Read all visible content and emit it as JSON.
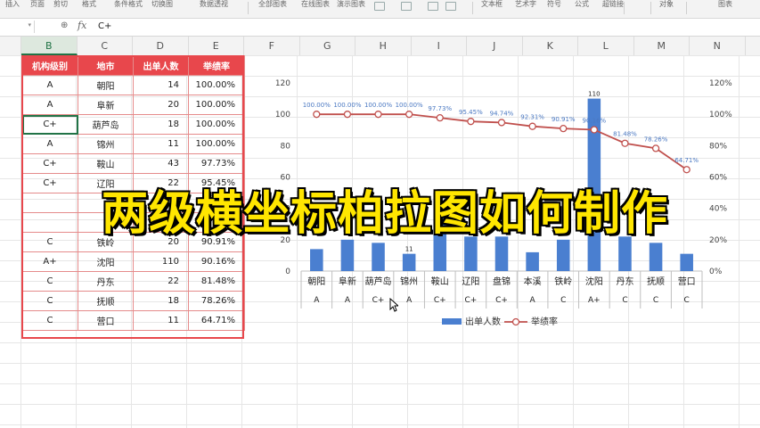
{
  "ribbon": {
    "items": [
      "插入",
      "页面",
      "剪切",
      "格式",
      "条件格式",
      "切换图",
      "数据透视",
      "全部图表",
      "在线图表",
      "演示图表",
      "文本框",
      "艺术字",
      "符号",
      "公式",
      "超链接",
      "对象",
      "图表"
    ]
  },
  "formula_bar": {
    "name_box": "",
    "zoom_icon": "⊕",
    "fx": "fx",
    "value": "C+"
  },
  "columns": [
    "B",
    "C",
    "D",
    "E",
    "F",
    "G",
    "H",
    "I",
    "J",
    "K",
    "L",
    "M",
    "N"
  ],
  "table": {
    "headers": [
      "机构级别",
      "地市",
      "出单人数",
      "举绩率"
    ],
    "rows": [
      [
        "A",
        "朝阳",
        "14",
        "100.00%"
      ],
      [
        "A",
        "阜新",
        "20",
        "100.00%"
      ],
      [
        "C+",
        "葫芦岛",
        "18",
        "100.00%"
      ],
      [
        "A",
        "锦州",
        "11",
        "100.00%"
      ],
      [
        "C+",
        "鞍山",
        "43",
        "97.73%"
      ],
      [
        "C+",
        "辽阳",
        "22",
        "95.45%"
      ],
      [
        "",
        "",
        "",
        ""
      ],
      [
        "",
        "",
        "",
        ""
      ],
      [
        "C",
        "铁岭",
        "20",
        "90.91%"
      ],
      [
        "A+",
        "沈阳",
        "110",
        "90.16%"
      ],
      [
        "C",
        "丹东",
        "22",
        "81.48%"
      ],
      [
        "C",
        "抚顺",
        "18",
        "78.26%"
      ],
      [
        "C",
        "营口",
        "11",
        "64.71%"
      ]
    ]
  },
  "chart_data": {
    "type": "bar",
    "categories": [
      "朝阳",
      "阜新",
      "葫芦岛",
      "锦州",
      "鞍山",
      "辽阳",
      "盘锦",
      "本溪",
      "铁岭",
      "沈阳",
      "丹东",
      "抚顺",
      "营口"
    ],
    "levels": [
      "A",
      "A",
      "C+",
      "A",
      "C+",
      "C+",
      "C+",
      "A",
      "C",
      "A+",
      "C",
      "C",
      "C"
    ],
    "series": [
      {
        "name": "出单人数",
        "type": "bar",
        "axis": "left",
        "values": [
          14,
          20,
          18,
          11,
          43,
          22,
          22,
          12,
          20,
          110,
          22,
          18,
          11
        ],
        "color": "#4a7fd0"
      },
      {
        "name": "举绩率",
        "type": "line",
        "axis": "right",
        "values": [
          1.0,
          1.0,
          1.0,
          1.0,
          0.9773,
          0.9545,
          0.9474,
          0.9231,
          0.9091,
          0.9016,
          0.8148,
          0.7826,
          0.6471
        ],
        "color": "#c0504d"
      }
    ],
    "pct_labels": [
      "100.00%",
      "100.00%",
      "100.00%",
      "100.00%",
      "97.73%",
      "95.45%",
      "94.74%",
      "92.31%",
      "90.91%",
      "90.16%",
      "81.48%",
      "78.26%",
      "64.71%"
    ],
    "bar_labels": [
      "11",
      "110"
    ],
    "y_left": {
      "min": 0,
      "max": 120,
      "ticks": [
        "0",
        "20",
        "40",
        "60",
        "80",
        "100",
        "120"
      ]
    },
    "y_right": {
      "min": 0,
      "max": 1.2,
      "ticks": [
        "0%",
        "20%",
        "40%",
        "60%",
        "80%",
        "100%",
        "120%"
      ]
    },
    "legend": [
      "出单人数",
      "举绩率"
    ],
    "legend_position": "bottom",
    "grid": false
  },
  "overlay_title": "两级横坐标柏拉图如何制作"
}
